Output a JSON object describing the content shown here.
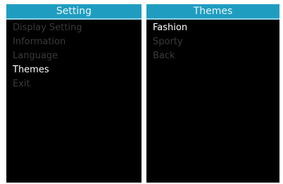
{
  "colors": {
    "title_bar": "#1f9dc1",
    "screen_background": "#000000",
    "item_selected": "#ffffff",
    "item_unselected": "#3a3a3a"
  },
  "left_screen": {
    "title": "Setting",
    "items": [
      {
        "label": "Display Setting",
        "selected": false
      },
      {
        "label": "Information",
        "selected": false
      },
      {
        "label": "Language",
        "selected": false
      },
      {
        "label": "Themes",
        "selected": true
      },
      {
        "label": "Exit",
        "selected": false
      }
    ]
  },
  "right_screen": {
    "title": "Themes",
    "items": [
      {
        "label": "Fashion",
        "selected": true
      },
      {
        "label": "Sporty",
        "selected": false
      },
      {
        "label": "Back",
        "selected": false
      }
    ]
  }
}
